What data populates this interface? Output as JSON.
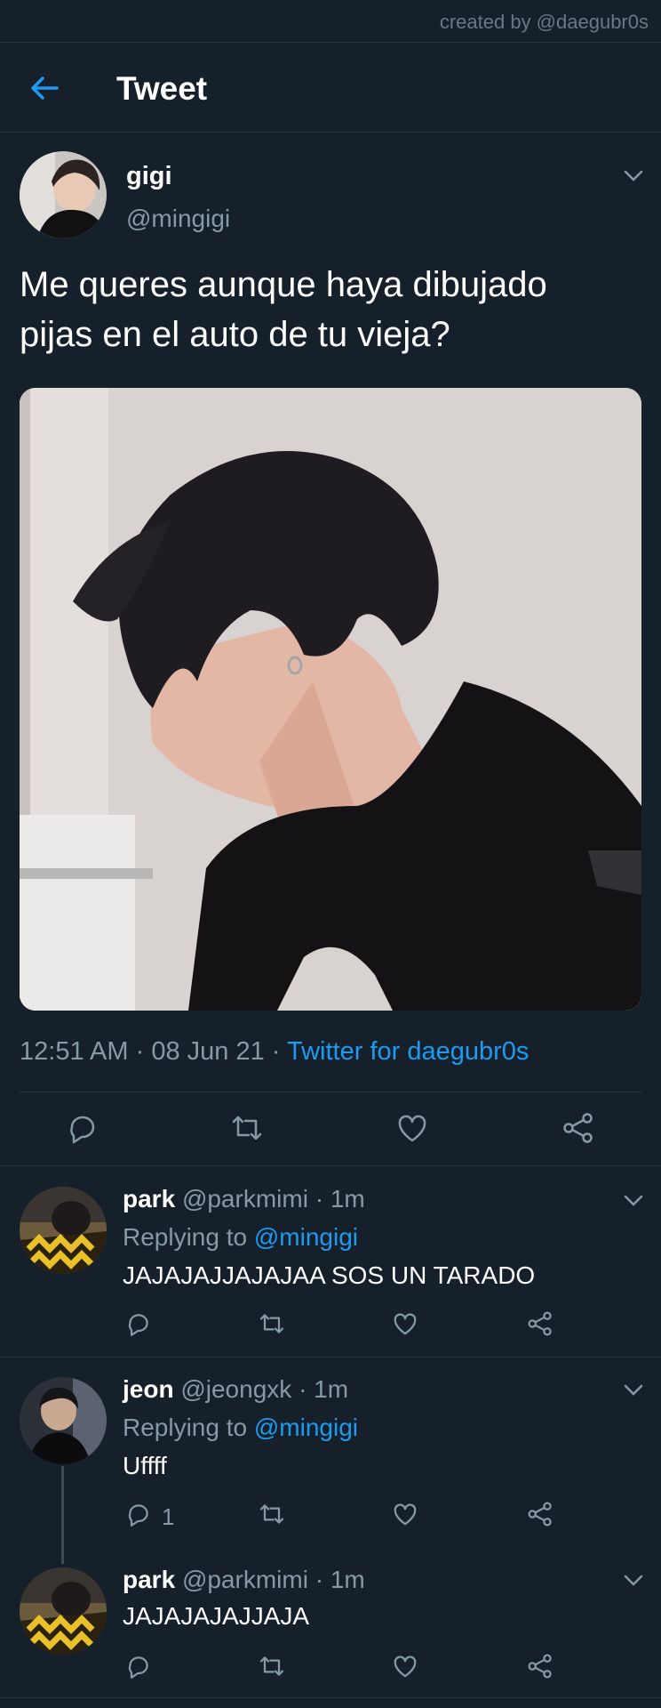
{
  "credit": "created by @daegubr0s",
  "header": {
    "title": "Tweet"
  },
  "tweet": {
    "name": "gigi",
    "handle": "@mingigi",
    "text_line1": "Me queres aunque haya dibujado",
    "text_line2": "pijas en el auto de tu vieja?",
    "time": "12:51 AM",
    "date": "08 Jun 21",
    "separator": "·",
    "source": "Twitter for daegubr0s"
  },
  "replies": [
    {
      "name": "park",
      "handle": "@parkmimi",
      "age": "1m",
      "replying_label": "Replying to",
      "mention": "@mingigi",
      "text": "JAJAJAJJAJAJAA SOS UN TARADO",
      "reply_count": ""
    },
    {
      "name": "jeon",
      "handle": "@jeongxk",
      "age": "1m",
      "replying_label": "Replying to",
      "mention": "@mingigi",
      "text": "Uffff",
      "reply_count": "1"
    },
    {
      "name": "park",
      "handle": "@parkmimi",
      "age": "1m",
      "text": "JAJAJAJAJJAJA",
      "reply_count": ""
    }
  ],
  "colors": {
    "background": "#15202b",
    "accent": "#1d9bf0",
    "muted": "#8899a6",
    "divider": "#2a3642"
  }
}
